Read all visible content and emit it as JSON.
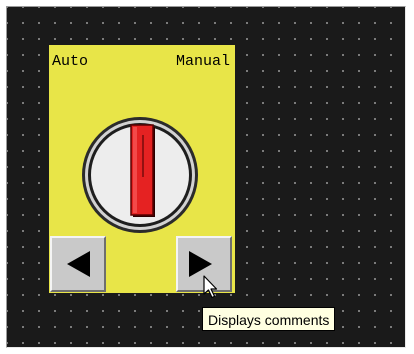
{
  "switch": {
    "left_label": "Auto",
    "right_label": "Manual",
    "state": "Manual",
    "panel_color": "#e8e548",
    "lever_color": "#e52222",
    "left_button_icon": "arrow-left-icon",
    "right_button_icon": "arrow-right-icon"
  },
  "tooltip": {
    "text": "Displays comments"
  },
  "cursor": {
    "icon": "mouse-pointer-icon"
  }
}
